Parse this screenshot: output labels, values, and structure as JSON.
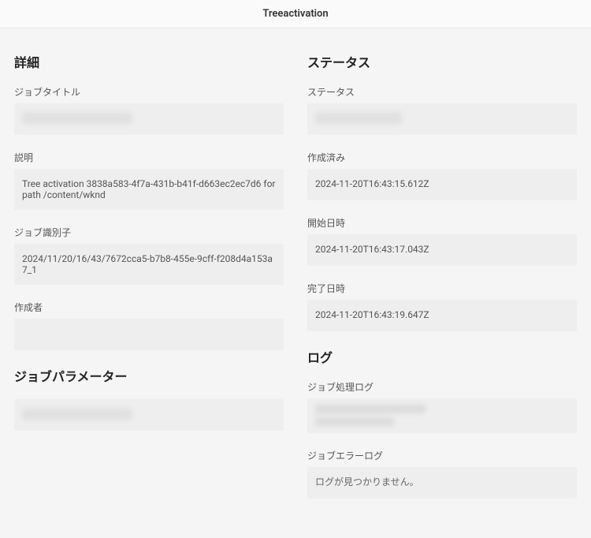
{
  "header": {
    "title": "Treeactivation"
  },
  "details": {
    "section_title": "詳細",
    "job_title": {
      "label": "ジョブタイトル",
      "value": ""
    },
    "description": {
      "label": "説明",
      "value": "Tree activation 3838a583-4f7a-431b-b41f-d663ec2ec7d6 for path /content/wknd"
    },
    "job_identifier": {
      "label": "ジョブ識別子",
      "value": "2024/11/20/16/43/7672cca5-b7b8-455e-9cff-f208d4a153a7_1"
    },
    "created_by": {
      "label": "作成者",
      "value": ""
    }
  },
  "status": {
    "section_title": "ステータス",
    "status": {
      "label": "ステータス",
      "value": ""
    },
    "created": {
      "label": "作成済み",
      "value": "2024-11-20T16:43:15.612Z"
    },
    "start": {
      "label": "開始日時",
      "value": "2024-11-20T16:43:17.043Z"
    },
    "end": {
      "label": "完了日時",
      "value": "2024-11-20T16:43:19.647Z"
    }
  },
  "job_parameters": {
    "section_title": "ジョブパラメーター",
    "value": ""
  },
  "log": {
    "section_title": "ログ",
    "processing_log": {
      "label": "ジョブ処理ログ",
      "value": ""
    },
    "error_log": {
      "label": "ジョブエラーログ",
      "value": "ログが見つかりません。"
    }
  }
}
